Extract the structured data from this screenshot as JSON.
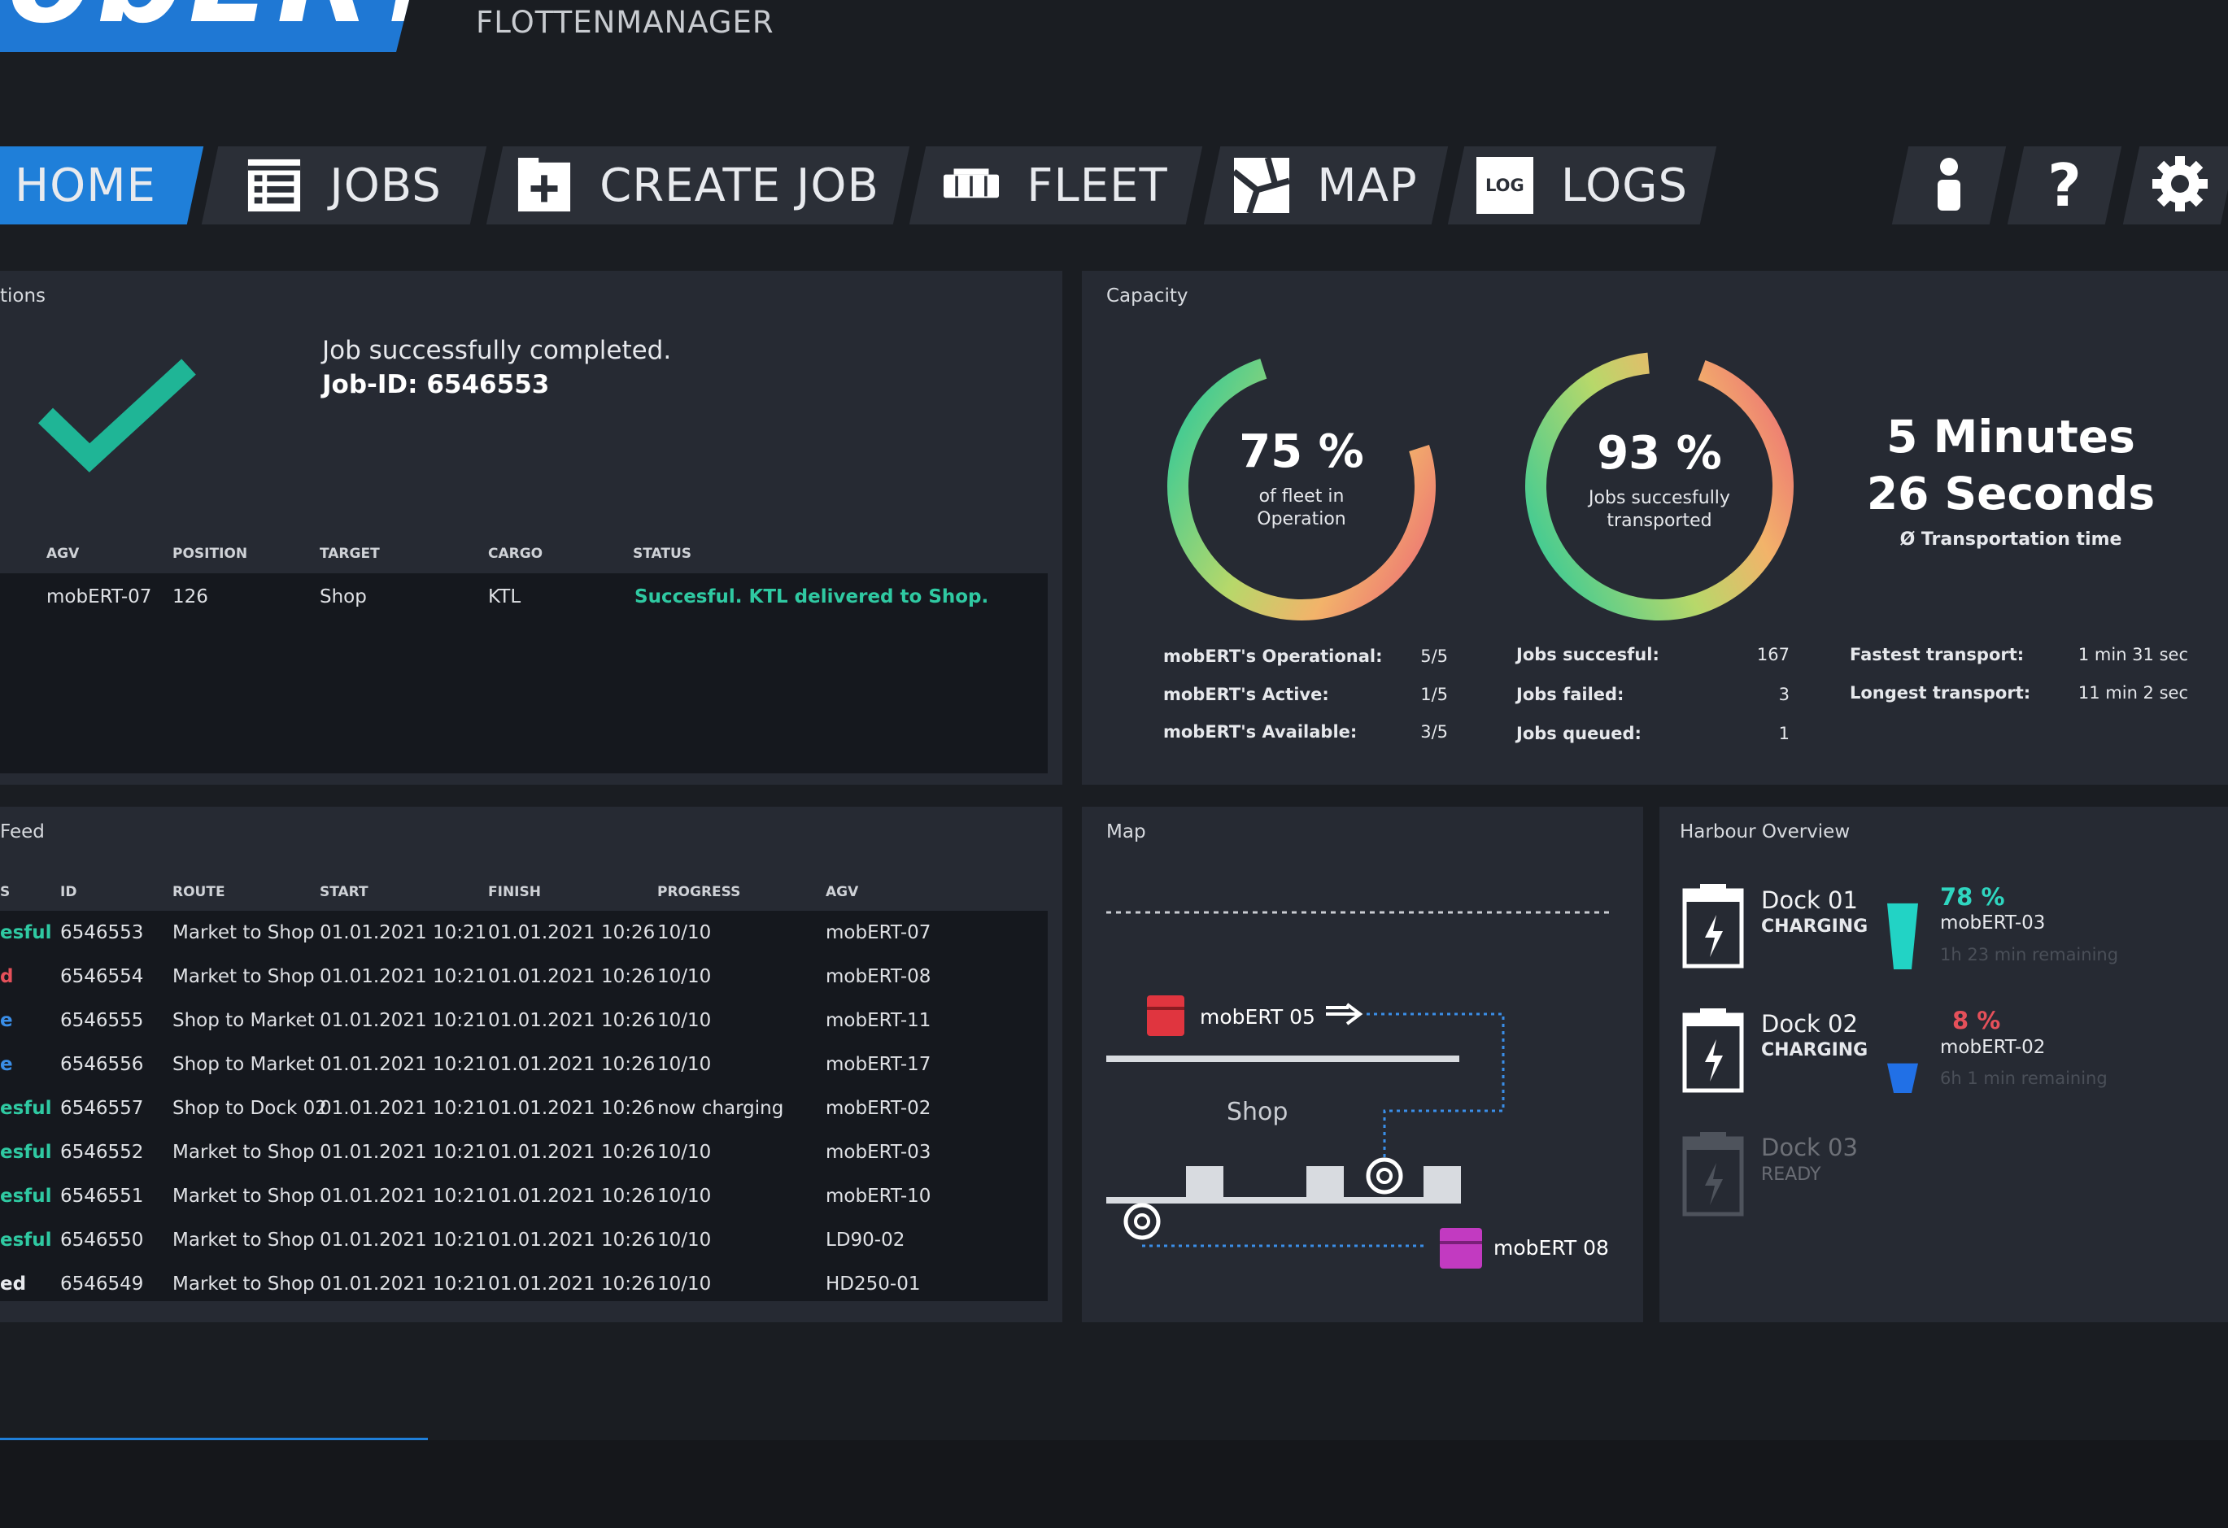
{
  "brand": {
    "logo_text": "obERT",
    "subtitle": "FLOTTENMANAGER"
  },
  "nav": {
    "home": "HOME",
    "jobs": "JOBS",
    "create_job": "CREATE JOB",
    "fleet": "FLEET",
    "map": "MAP",
    "logs": "LOGS",
    "logs_icon_text": "LOG"
  },
  "notifications": {
    "title": "tions",
    "message": "Job successfully completed.",
    "job_id": "Job-ID: 6546553",
    "columns": [
      "AGV",
      "POSITION",
      "TARGET",
      "CARGO",
      "STATUS"
    ],
    "row": {
      "agv": "mobERT-07",
      "position": "126",
      "target": "Shop",
      "cargo": "KTL",
      "status": "Succesful. KTL delivered to Shop."
    }
  },
  "capacity": {
    "title": "Capacity",
    "gauge1": {
      "value": "75 %",
      "line1": "of fleet in",
      "line2": "Operation",
      "fraction": 0.75
    },
    "gauge2": {
      "value": "93 %",
      "line1": "Jobs succesfully",
      "line2": "transported",
      "fraction": 0.93
    },
    "time": {
      "line1": "5 Minutes",
      "line2": "26 Seconds",
      "caption": "Ø Transportation time"
    },
    "stats1": [
      {
        "label": "mobERT's Operational:",
        "value": "5/5"
      },
      {
        "label": "mobERT's Active:",
        "value": "1/5"
      },
      {
        "label": "mobERT's Available:",
        "value": "3/5"
      }
    ],
    "stats2": [
      {
        "label": "Jobs succesful:",
        "value": "167"
      },
      {
        "label": "Jobs failed:",
        "value": "3"
      },
      {
        "label": "Jobs queued:",
        "value": "1"
      }
    ],
    "stats3": [
      {
        "label": "Fastest transport:",
        "value": "1 min 31 sec"
      },
      {
        "label": "Longest transport:",
        "value": "11 min 2 sec"
      }
    ]
  },
  "feed": {
    "title": "Feed",
    "columns": [
      "S",
      "ID",
      "ROUTE",
      "START",
      "FINISH",
      "PROGRESS",
      "AGV"
    ],
    "rows": [
      {
        "status": "esful",
        "status_color": "#2fc9a2",
        "id": "6546553",
        "route": "Market to Shop",
        "start": "01.01.2021 10:21",
        "finish": "01.01.2021 10:26",
        "progress": "10/10",
        "agv": "mobERT-07"
      },
      {
        "status": "d",
        "status_color": "#e5505a",
        "id": "6546554",
        "route": "Market to Shop",
        "start": "01.01.2021 10:21",
        "finish": "01.01.2021 10:26",
        "progress": "10/10",
        "agv": "mobERT-08"
      },
      {
        "status": "e",
        "status_color": "#3a8ee8",
        "id": "6546555",
        "route": "Shop to Market",
        "start": "01.01.2021 10:21",
        "finish": "01.01.2021 10:26",
        "progress": "10/10",
        "agv": "mobERT-11"
      },
      {
        "status": "e",
        "status_color": "#3a8ee8",
        "id": "6546556",
        "route": "Shop to Market",
        "start": "01.01.2021 10:21",
        "finish": "01.01.2021 10:26",
        "progress": "10/10",
        "agv": "mobERT-17"
      },
      {
        "status": "esful",
        "status_color": "#2fc9a2",
        "id": "6546557",
        "route": "Shop to Dock 02",
        "start": "01.01.2021 10:21",
        "finish": "01.01.2021 10:26",
        "progress": "now charging",
        "agv": "mobERT-02"
      },
      {
        "status": "esful",
        "status_color": "#2fc9a2",
        "id": "6546552",
        "route": "Market to Shop",
        "start": "01.01.2021 10:21",
        "finish": "01.01.2021 10:26",
        "progress": "10/10",
        "agv": "mobERT-03"
      },
      {
        "status": "esful",
        "status_color": "#2fc9a2",
        "id": "6546551",
        "route": "Market to Shop",
        "start": "01.01.2021 10:21",
        "finish": "01.01.2021 10:26",
        "progress": "10/10",
        "agv": "mobERT-10"
      },
      {
        "status": "esful",
        "status_color": "#2fc9a2",
        "id": "6546550",
        "route": "Market to Shop",
        "start": "01.01.2021 10:21",
        "finish": "01.01.2021 10:26",
        "progress": "10/10",
        "agv": "LD90-02"
      },
      {
        "status": "ed",
        "status_color": "#e8eaee",
        "id": "6546549",
        "route": "Market to Shop",
        "start": "01.01.2021 10:21",
        "finish": "01.01.2021 10:26",
        "progress": "10/10",
        "agv": "HD250-01"
      }
    ]
  },
  "map": {
    "title": "Map",
    "agv1": "mobERT 05",
    "agv2": "mobERT 08",
    "shop_label": "Shop"
  },
  "harbour": {
    "title": "Harbour Overview",
    "docks": [
      {
        "name": "Dock 01",
        "state": "CHARGING",
        "percent": "78 %",
        "percent_color": "#2fd6c0",
        "agv": "mobERT-03",
        "remaining": "1h 23 min remaining",
        "level": 0.78,
        "bar_color": "#22d3c5"
      },
      {
        "name": "Dock 02",
        "state": "CHARGING",
        "percent": "8 %",
        "percent_color": "#e5505a",
        "agv": "mobERT-02",
        "remaining": "6h 1 min remaining",
        "level": 0.08,
        "bar_color": "#2170e6"
      },
      {
        "name": "Dock 03",
        "state": "READY"
      }
    ]
  }
}
